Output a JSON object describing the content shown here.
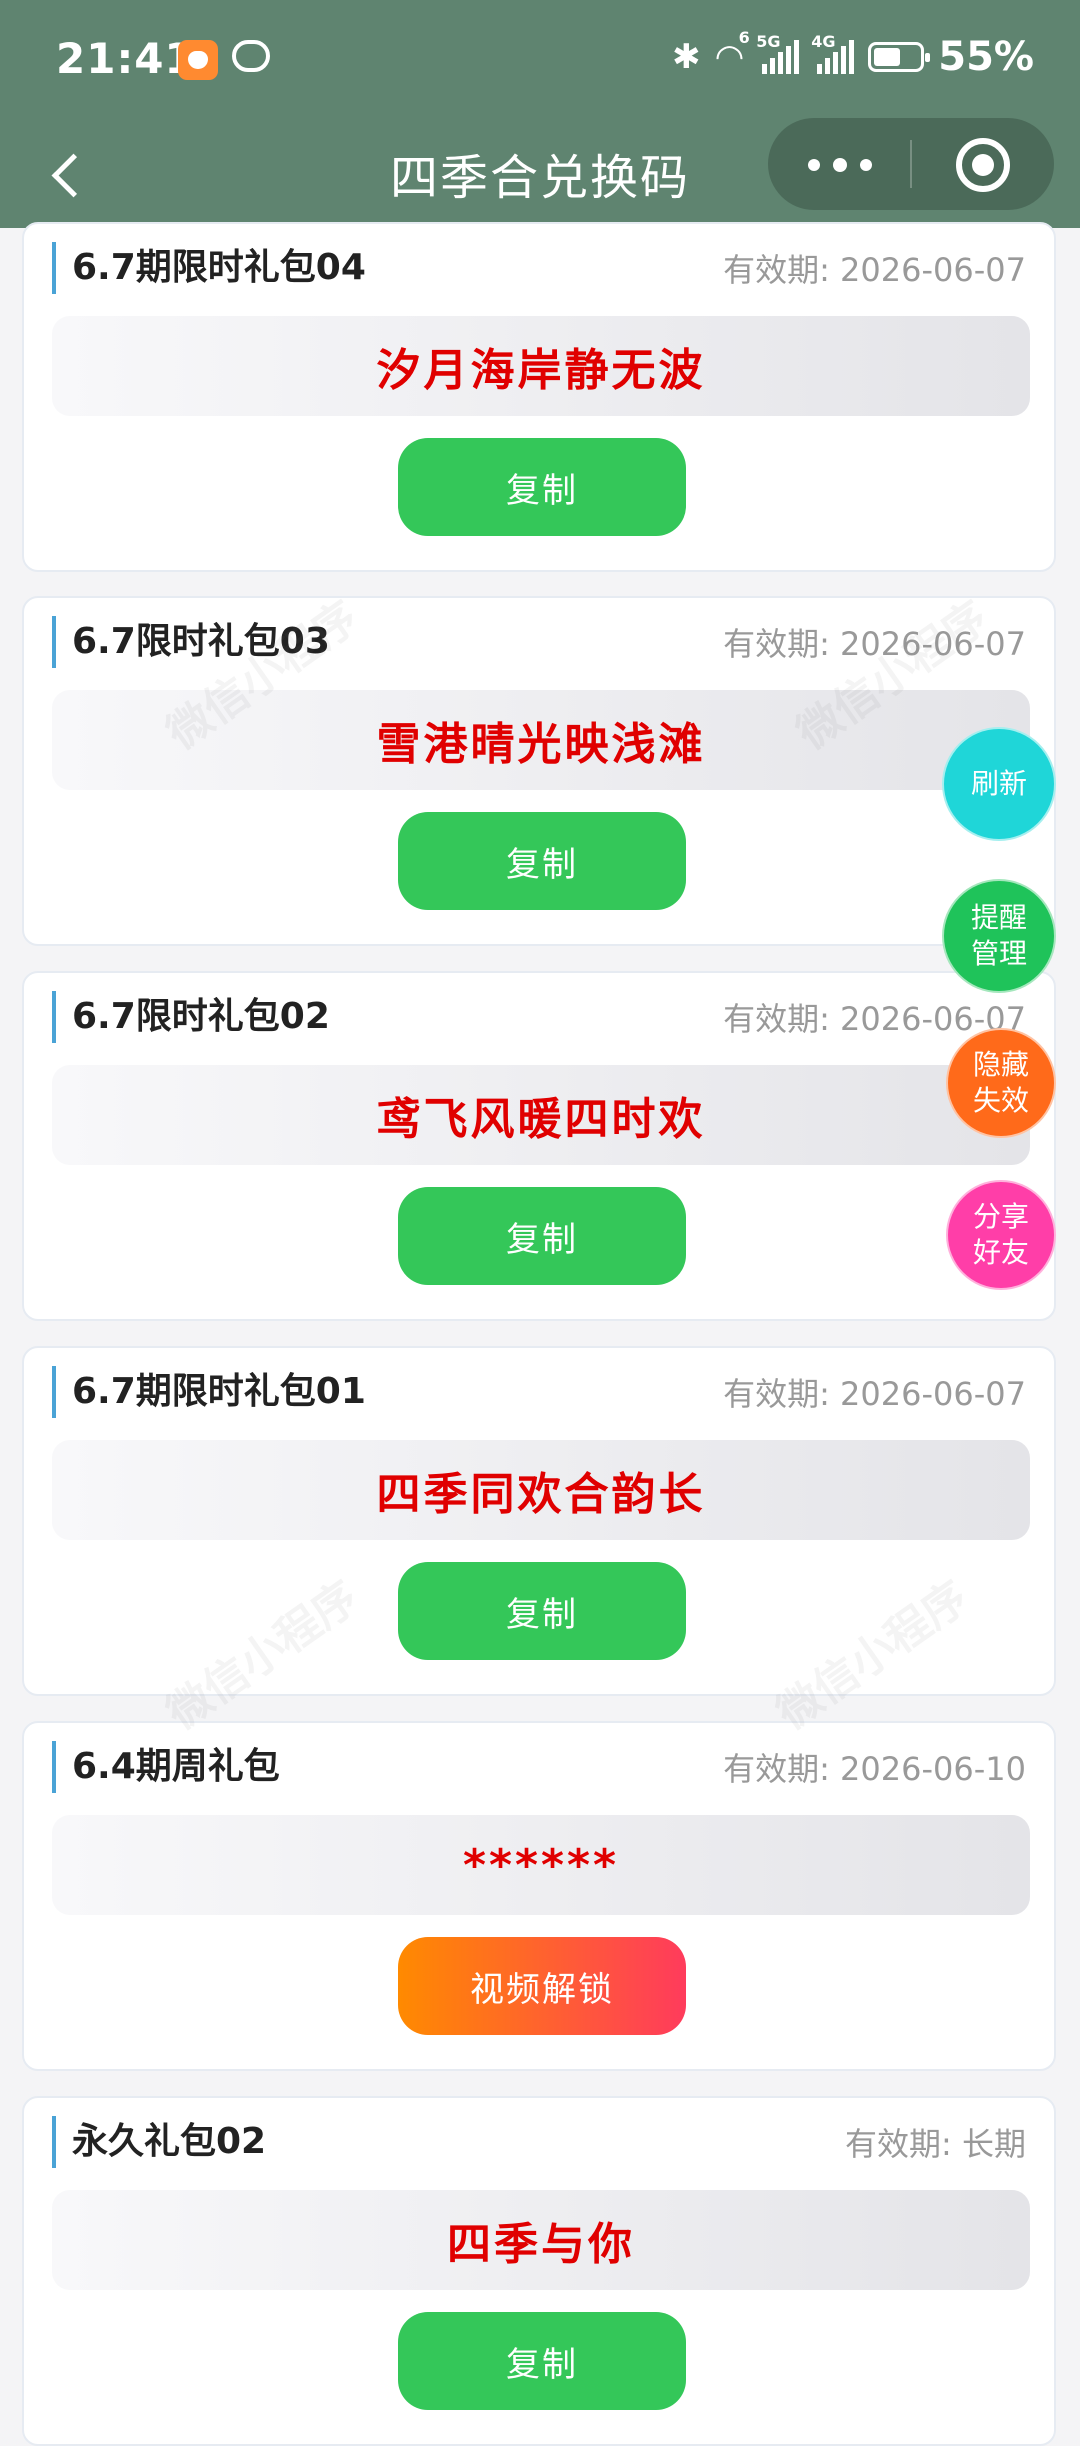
{
  "status_bar": {
    "time": "21:41",
    "wifi_badge": "6",
    "signal1_badge": "5G",
    "signal2_badge": "4G",
    "battery_percent": "55%"
  },
  "nav": {
    "title": "四季合兑换码"
  },
  "cards": [
    {
      "title": "6.7期限时礼包04",
      "expiry": "有效期: 2026-06-07",
      "code": "汐月海岸静无波",
      "action": "复制",
      "action_type": "copy"
    },
    {
      "title": "6.7限时礼包03",
      "expiry": "有效期: 2026-06-07",
      "code": "雪港晴光映浅滩",
      "action": "复制",
      "action_type": "copy"
    },
    {
      "title": "6.7限时礼包02",
      "expiry": "有效期: 2026-06-07",
      "code": "鸢飞风暖四时欢",
      "action": "复制",
      "action_type": "copy"
    },
    {
      "title": "6.7期限时礼包01",
      "expiry": "有效期: 2026-06-07",
      "code": "四季同欢合韵长",
      "action": "复制",
      "action_type": "copy"
    },
    {
      "title": "6.4期周礼包",
      "expiry": "有效期: 2026-06-10",
      "code": "******",
      "action": "视频解锁",
      "action_type": "unlock"
    },
    {
      "title": "永久礼包02",
      "expiry": "有效期: 长期",
      "code": "四季与你",
      "action": "复制",
      "action_type": "copy"
    }
  ],
  "floating": {
    "refresh": "刷新",
    "reminder_line1": "提醒",
    "reminder_line2": "管理",
    "hide_line1": "隐藏",
    "hide_line2": "失效",
    "share_line1": "分享",
    "share_line2": "好友"
  },
  "colors": {
    "header": "#5f8470",
    "code_text": "#e00000",
    "copy_button": "#34c759",
    "refresh_button": "#1fd6d8",
    "reminder_button": "#1fc35a",
    "hide_button": "#ff6a1a",
    "share_button": "#ff3ea8"
  }
}
